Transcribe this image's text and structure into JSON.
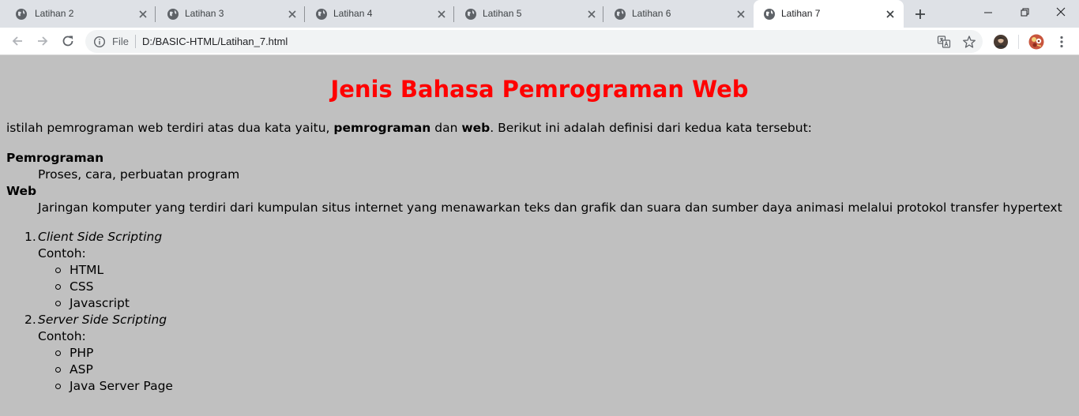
{
  "browser": {
    "tabs": [
      {
        "label": "Latihan 2",
        "active": false
      },
      {
        "label": "Latihan 3",
        "active": false
      },
      {
        "label": "Latihan 4",
        "active": false
      },
      {
        "label": "Latihan 5",
        "active": false
      },
      {
        "label": "Latihan 6",
        "active": false
      },
      {
        "label": "Latihan 7",
        "active": true
      }
    ],
    "address": {
      "scheme_label": "File",
      "url": "D:/BASIC-HTML/Latihan_7.html"
    },
    "icons": [
      "globe-icon",
      "close-icon",
      "new-tab-icon",
      "minimize-icon",
      "restore-icon",
      "window-close-icon",
      "back-icon",
      "forward-icon",
      "reload-icon",
      "info-icon",
      "translate-icon",
      "star-icon",
      "profile-avatar",
      "extension-avatar",
      "menu-icon"
    ]
  },
  "page": {
    "title": "Jenis Bahasa Pemrograman Web",
    "intro": {
      "prefix": "istilah pemrograman web terdiri atas dua kata yaitu, ",
      "bold1": "pemrograman",
      "middle": " dan ",
      "bold2": "web",
      "suffix": ". Berikut ini adalah definisi dari kedua kata tersebut:"
    },
    "definitions": [
      {
        "term": "Pemrograman",
        "desc": "Proses, cara, perbuatan program"
      },
      {
        "term": "Web",
        "desc": "Jaringan komputer yang terdiri dari kumpulan situs internet yang menawarkan teks dan grafik dan suara dan sumber daya animasi melalui protokol transfer hypertext"
      }
    ],
    "list": [
      {
        "marker": "1.",
        "name": "Client Side Scripting",
        "example_label": "Contoh:",
        "items": [
          "HTML",
          "CSS",
          "Javascript"
        ]
      },
      {
        "marker": "2.",
        "name": "Server Side Scripting",
        "example_label": "Contoh:",
        "items": [
          "PHP",
          "ASP",
          "Java Server Page"
        ]
      }
    ]
  },
  "colors": {
    "title": "#ff0000",
    "page_background": "#c0c0c0",
    "tabstrip": "#dee1e6"
  }
}
